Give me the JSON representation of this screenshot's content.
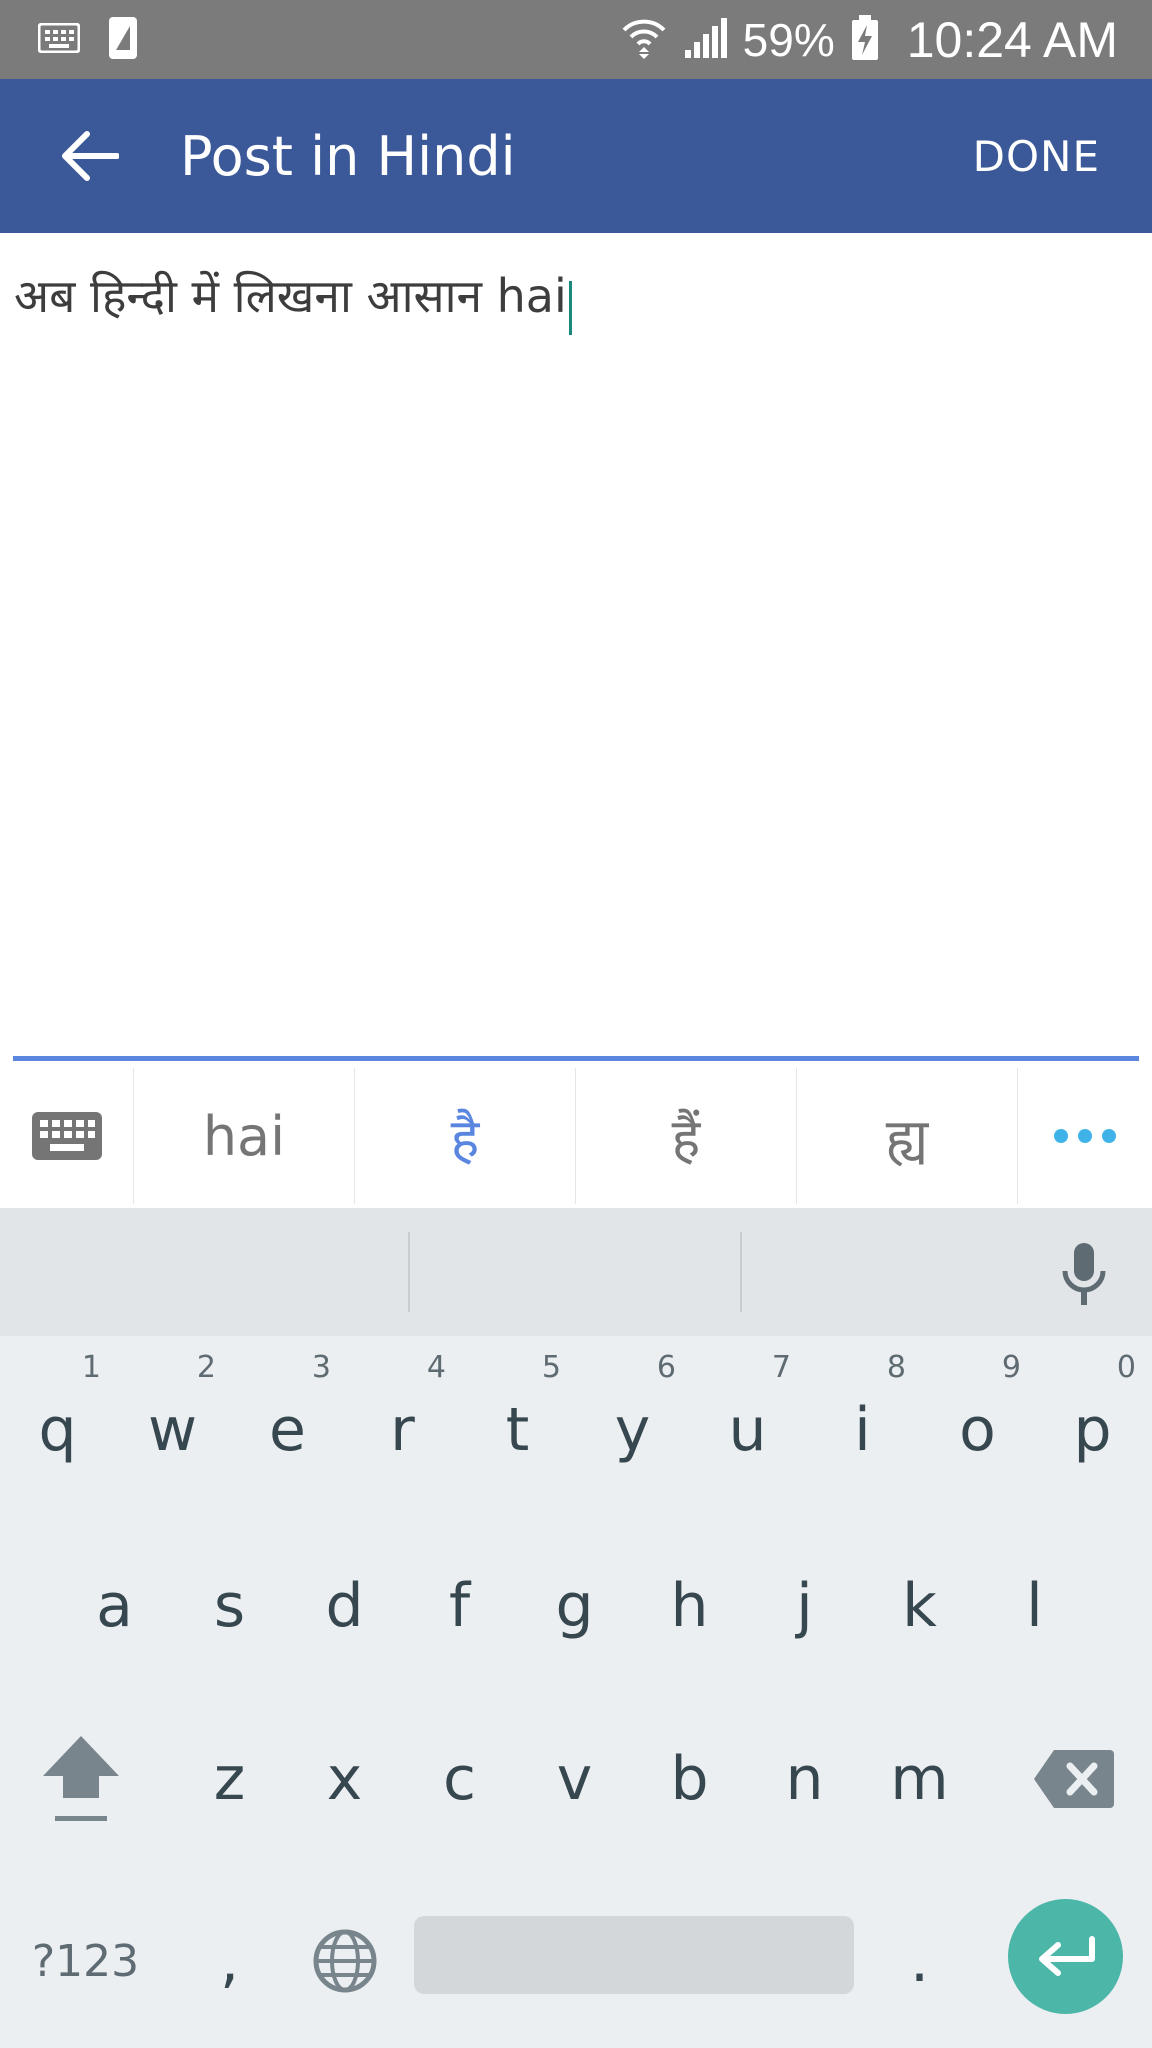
{
  "status": {
    "battery": "59%",
    "time": "10:24 AM"
  },
  "app_bar": {
    "title": "Post in Hindi",
    "done_label": "DONE"
  },
  "editor": {
    "text": "अब हिन्दी में लिखना आसान hai"
  },
  "suggestions": [
    "hai",
    "है",
    "हैं",
    "ह्य"
  ],
  "keyboard": {
    "row1": [
      {
        "l": "q",
        "h": "1"
      },
      {
        "l": "w",
        "h": "2"
      },
      {
        "l": "e",
        "h": "3"
      },
      {
        "l": "r",
        "h": "4"
      },
      {
        "l": "t",
        "h": "5"
      },
      {
        "l": "y",
        "h": "6"
      },
      {
        "l": "u",
        "h": "7"
      },
      {
        "l": "i",
        "h": "8"
      },
      {
        "l": "o",
        "h": "9"
      },
      {
        "l": "p",
        "h": "0"
      }
    ],
    "row2": [
      "a",
      "s",
      "d",
      "f",
      "g",
      "h",
      "j",
      "k",
      "l"
    ],
    "row3": [
      "z",
      "x",
      "c",
      "v",
      "b",
      "n",
      "m"
    ],
    "symbols_label": "?123",
    "comma_label": ",",
    "period_label": "."
  },
  "colors": {
    "app_bar": "#3b5998",
    "status_bar": "#7b7b7b",
    "accent": "#5b86e0",
    "enter": "#4cb6a9",
    "dots": "#3fb3e8"
  }
}
